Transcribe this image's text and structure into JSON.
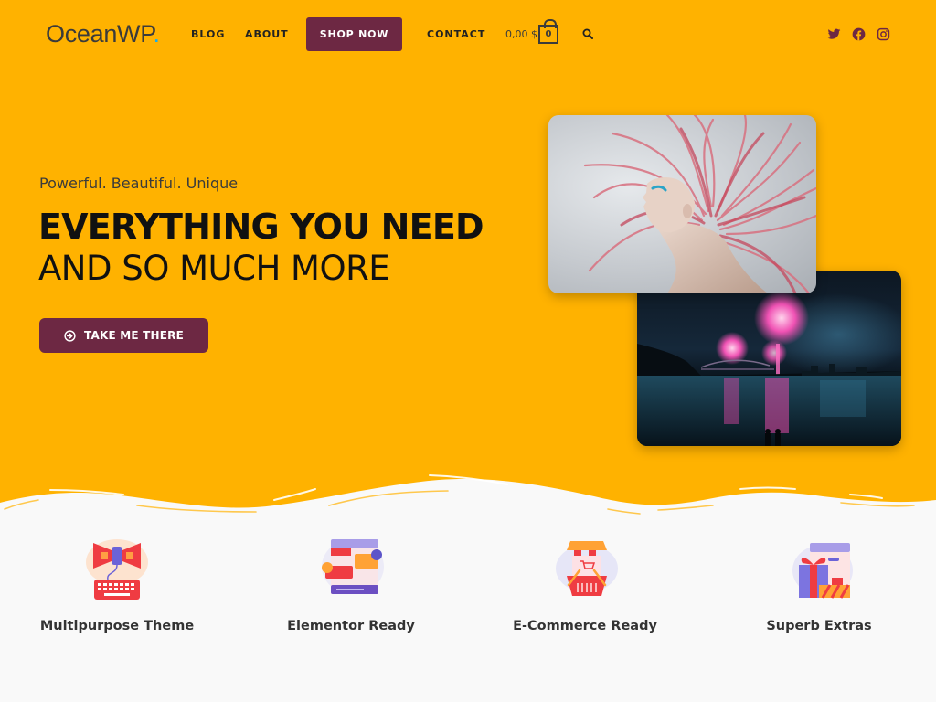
{
  "header": {
    "logo_text": "OceanWP",
    "logo_dot": ".",
    "nav": [
      {
        "label": "BLOG"
      },
      {
        "label": "ABOUT"
      },
      {
        "label": "SHOP NOW"
      },
      {
        "label": "CONTACT"
      }
    ],
    "cart_amount": "0,00 $",
    "cart_count": "0",
    "social": [
      "twitter-icon",
      "facebook-icon",
      "instagram-icon"
    ]
  },
  "hero": {
    "tagline": "Powerful. Beautiful. Unique",
    "headline_bold": "EVERYTHING YOU NEED",
    "headline_light": "AND SO MUCH MORE",
    "cta_label": "TAKE ME THERE",
    "images": [
      {
        "subject": "woman with pink hair"
      },
      {
        "subject": "fireworks over harbor at night"
      }
    ]
  },
  "features": [
    {
      "label": "Multipurpose Theme",
      "icon": "megaphone-keyboard-icon"
    },
    {
      "label": "Elementor Ready",
      "icon": "chat-panels-icon"
    },
    {
      "label": "E-Commerce Ready",
      "icon": "shop-basket-icon"
    },
    {
      "label": "Superb Extras",
      "icon": "gift-box-icon"
    }
  ],
  "colors": {
    "hero_bg": "#ffb200",
    "accent": "#6d2843",
    "logo_dot": "#13aff0",
    "page_bg": "#f9f9f9"
  }
}
